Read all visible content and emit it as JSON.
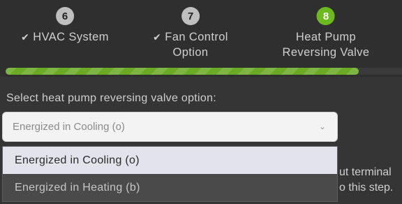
{
  "steps": [
    {
      "number": "6",
      "label": "HVAC System",
      "check": "✔",
      "state": "completed"
    },
    {
      "number": "7",
      "label_line1": "Fan Control",
      "label_line2": "Option",
      "check": "✔",
      "state": "completed"
    },
    {
      "number": "8",
      "label_line1": "Heat Pump",
      "label_line2": "Reversing Valve",
      "state": "active"
    }
  ],
  "progress": {
    "percent": 89
  },
  "form": {
    "prompt": "Select heat pump reversing valve option:",
    "select": {
      "value": "Energized in Cooling (o)",
      "arrow": "⌄"
    },
    "options": [
      "Energized in Cooling (o)",
      "Energized in Heating (b)"
    ]
  },
  "background_text": {
    "line1": "ut terminal",
    "line2": "o this step."
  },
  "colors": {
    "active_step": "#6dba1f",
    "progress": "#6aaa24",
    "background": "#353535"
  }
}
